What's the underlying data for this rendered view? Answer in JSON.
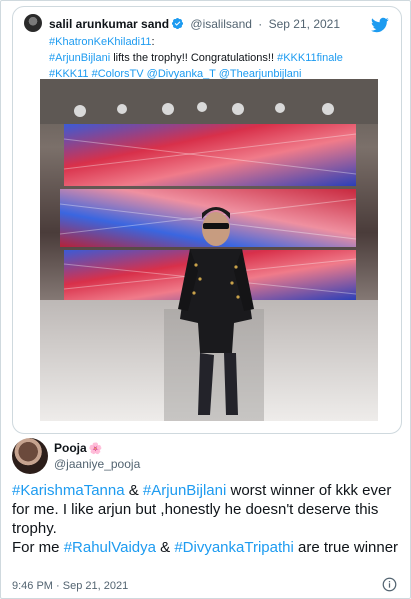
{
  "quoted": {
    "name": "salil arunkumar sand",
    "handle": "@isalilsand",
    "separator": "·",
    "date": "Sep 21, 2021",
    "line1": {
      "hashtag": "#KhatronKeKhiladi11",
      "suffix": ":"
    },
    "line2": {
      "hashtag": "#ArjunBijlani",
      "middle": " lifts the trophy!! Congratulations!! ",
      "hashtag2": "#KKK11finale"
    },
    "line3": {
      "t1": "#KKK11",
      "t2": "#ColorsTV",
      "t3": "@Divyanka_T",
      "t4": "@Thearjunbijlani"
    }
  },
  "main": {
    "name": "Pooja",
    "flower": "🌸",
    "handle": "@jaaniye_pooja",
    "p1": {
      "h1": "#KarishmaTanna",
      "amp": " & ",
      "h2": "#ArjunBijlani",
      "rest": "  worst winner of kkk ever for me. I like arjun but ,honestly he doesn't deserve this trophy."
    },
    "p2": {
      "start": "For me ",
      "h1": "#RahulVaidya",
      "amp": " &  ",
      "h2": "#DivyankaTripathi",
      "rest": "  are true winner"
    },
    "time": "9:46 PM",
    "separator": "·",
    "date": "Sep 21, 2021"
  },
  "colors": {
    "link": "#1d9bf0",
    "secondary": "#536471",
    "twitter_blue": "#1d9bf0"
  },
  "icons": [
    "verified-badge-icon",
    "twitter-bird-icon",
    "info-icon"
  ]
}
